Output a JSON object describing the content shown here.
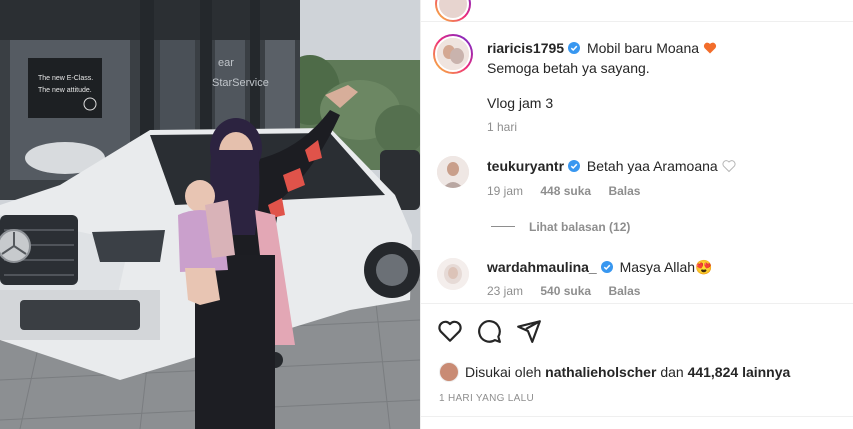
{
  "post": {
    "author": "riaricis1795",
    "caption_line1": "Mobil baru Moana",
    "caption_line2": "Semoga betah ya sayang.",
    "caption_line3": "Vlog jam 3",
    "time": "1 hari"
  },
  "photo": {
    "sign_text_a": "The new E-Class.",
    "sign_text_b": "The new attitude.",
    "store_sign": "ear\nStarService"
  },
  "comments": [
    {
      "username": "teukuryantr",
      "text": "Betah yaa Aramoana",
      "time": "19 jam",
      "likes": "448 suka",
      "reply": "Balas"
    },
    {
      "username": "wardahmaulina_",
      "text": "Masya Allah",
      "emoji": "😍",
      "time": "23 jam",
      "likes": "540 suka",
      "reply": "Balas"
    }
  ],
  "view_replies": "Lihat balasan (12)",
  "likes_line": {
    "prefix": "Disukai oleh",
    "user": "nathalieholscher",
    "middle": "dan",
    "count": "441,824",
    "suffix": "lainnya"
  },
  "date": "1 HARI YANG LALU",
  "colors": {
    "verified": "#3897f0",
    "heart_orange": "#f26d2b",
    "muted": "#8e8e8e"
  },
  "icons": {
    "like": "heart-outline",
    "comment": "speech-bubble",
    "share": "paper-plane"
  }
}
